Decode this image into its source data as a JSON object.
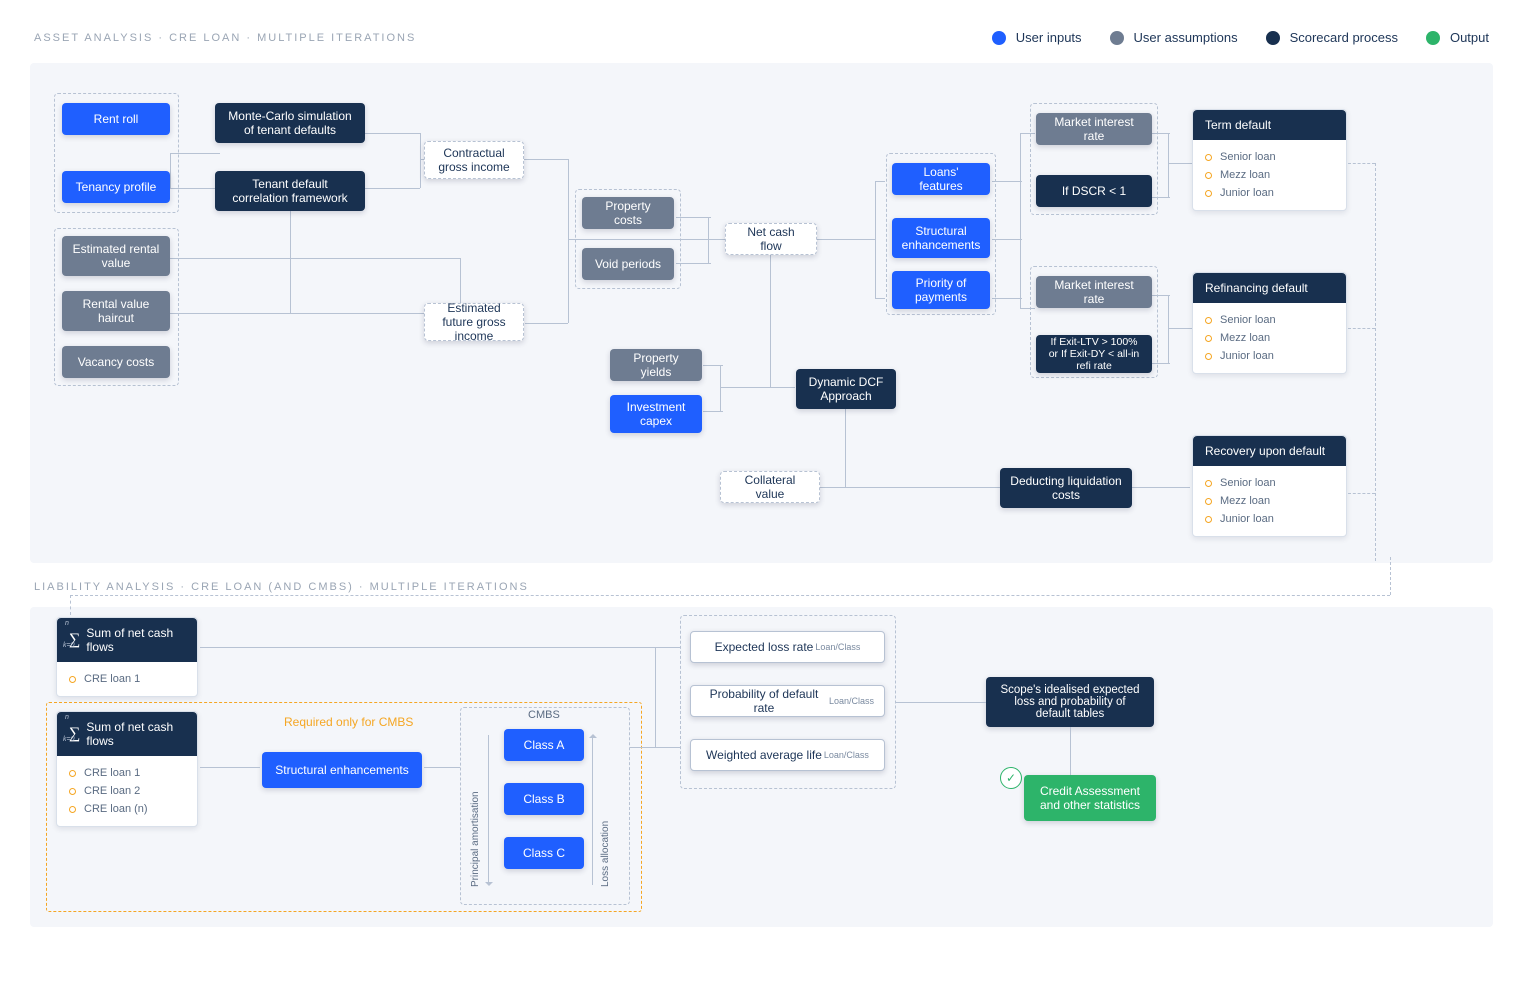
{
  "colors": {
    "userInput": "#1f5fff",
    "userAssumption": "#6e7c91",
    "scorecard": "#18304f",
    "output": "#2db46a"
  },
  "legend": [
    {
      "label": "User inputs",
      "color": "#1f5fff"
    },
    {
      "label": "User assumptions",
      "color": "#6e7c91"
    },
    {
      "label": "Scorecard process",
      "color": "#18304f"
    },
    {
      "label": "Output",
      "color": "#2db46a"
    }
  ],
  "asset": {
    "title": "ASSET ANALYSIS · CRE LOAN · MULTIPLE ITERATIONS",
    "rentRoll": "Rent roll",
    "tenancyProfile": "Tenancy profile",
    "monteCarlo": "Monte-Carlo simulation of tenant defaults",
    "tenantDefault": "Tenant default correlation framework",
    "contractualGross": "Contractual gross income",
    "erv": "Estimated rental value",
    "haircut": "Rental value haircut",
    "vacancy": "Vacancy costs",
    "futureGross": "Estimated future gross income",
    "propertyCosts": "Property costs",
    "voidPeriods": "Void periods",
    "netCashFlow": "Net cash flow",
    "loansFeatures": "Loans' features",
    "structuralEnh": "Structural enhancements",
    "priorityPayments": "Priority of payments",
    "marketInterest1": "Market interest rate",
    "marketInterest2": "Market interest rate",
    "dscr": "If DSCR < 1",
    "exitLtv": "If Exit-LTV > 100% or If Exit-DY < all-in refi rate",
    "propertyYields": "Property yields",
    "investmentCapex": "Investment capex",
    "dcf": "Dynamic DCF Approach",
    "collateral": "Collateral value",
    "liqCosts": "Deducting liquidation costs",
    "termDefault": {
      "head": "Term default",
      "rows": [
        "Senior loan",
        "Mezz loan",
        "Junior loan"
      ]
    },
    "refiDefault": {
      "head": "Refinancing default",
      "rows": [
        "Senior loan",
        "Mezz loan",
        "Junior loan"
      ]
    },
    "recovery": {
      "head": "Recovery upon default",
      "rows": [
        "Senior loan",
        "Mezz loan",
        "Junior loan"
      ]
    }
  },
  "liability": {
    "title": "LIABILITY ANALYSIS · CRE LOAN (AND CMBS) · MULTIPLE ITERATIONS",
    "sumLabel": "Sum of net cash flows",
    "single": [
      "CRE loan 1"
    ],
    "multi": [
      "CRE loan 1",
      "CRE loan 2",
      "CRE loan (n)"
    ],
    "cmbsNote": "Required only for CMBS",
    "structEnh": "Structural enhancements",
    "cmbsTitle": "CMBS",
    "classes": [
      "Class A",
      "Class B",
      "Class C"
    ],
    "principalAmort": "Principal amortisation",
    "lossAlloc": "Loss allocation",
    "metrics": {
      "elr": "Expected loss rate",
      "pdr": "Probability of default rate",
      "wal": "Weighted average life",
      "sub": "Loan/Class"
    },
    "scopeTables": "Scope's idealised expected loss and probability of default tables",
    "credit": "Credit Assessment and other statistics"
  }
}
